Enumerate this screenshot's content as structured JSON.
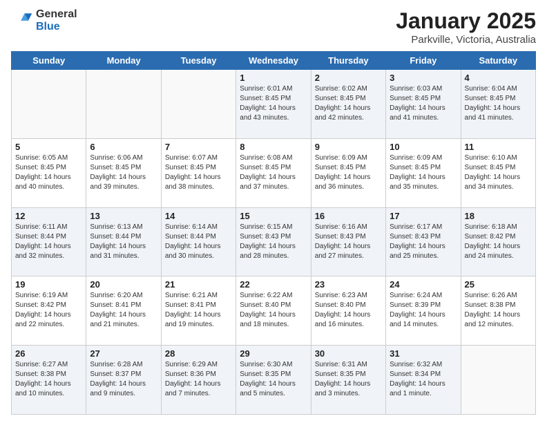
{
  "header": {
    "logo_general": "General",
    "logo_blue": "Blue",
    "title": "January 2025",
    "location": "Parkville, Victoria, Australia"
  },
  "weekdays": [
    "Sunday",
    "Monday",
    "Tuesday",
    "Wednesday",
    "Thursday",
    "Friday",
    "Saturday"
  ],
  "weeks": [
    [
      {
        "day": "",
        "info": ""
      },
      {
        "day": "",
        "info": ""
      },
      {
        "day": "",
        "info": ""
      },
      {
        "day": "1",
        "info": "Sunrise: 6:01 AM\nSunset: 8:45 PM\nDaylight: 14 hours\nand 43 minutes."
      },
      {
        "day": "2",
        "info": "Sunrise: 6:02 AM\nSunset: 8:45 PM\nDaylight: 14 hours\nand 42 minutes."
      },
      {
        "day": "3",
        "info": "Sunrise: 6:03 AM\nSunset: 8:45 PM\nDaylight: 14 hours\nand 41 minutes."
      },
      {
        "day": "4",
        "info": "Sunrise: 6:04 AM\nSunset: 8:45 PM\nDaylight: 14 hours\nand 41 minutes."
      }
    ],
    [
      {
        "day": "5",
        "info": "Sunrise: 6:05 AM\nSunset: 8:45 PM\nDaylight: 14 hours\nand 40 minutes."
      },
      {
        "day": "6",
        "info": "Sunrise: 6:06 AM\nSunset: 8:45 PM\nDaylight: 14 hours\nand 39 minutes."
      },
      {
        "day": "7",
        "info": "Sunrise: 6:07 AM\nSunset: 8:45 PM\nDaylight: 14 hours\nand 38 minutes."
      },
      {
        "day": "8",
        "info": "Sunrise: 6:08 AM\nSunset: 8:45 PM\nDaylight: 14 hours\nand 37 minutes."
      },
      {
        "day": "9",
        "info": "Sunrise: 6:09 AM\nSunset: 8:45 PM\nDaylight: 14 hours\nand 36 minutes."
      },
      {
        "day": "10",
        "info": "Sunrise: 6:09 AM\nSunset: 8:45 PM\nDaylight: 14 hours\nand 35 minutes."
      },
      {
        "day": "11",
        "info": "Sunrise: 6:10 AM\nSunset: 8:45 PM\nDaylight: 14 hours\nand 34 minutes."
      }
    ],
    [
      {
        "day": "12",
        "info": "Sunrise: 6:11 AM\nSunset: 8:44 PM\nDaylight: 14 hours\nand 32 minutes."
      },
      {
        "day": "13",
        "info": "Sunrise: 6:13 AM\nSunset: 8:44 PM\nDaylight: 14 hours\nand 31 minutes."
      },
      {
        "day": "14",
        "info": "Sunrise: 6:14 AM\nSunset: 8:44 PM\nDaylight: 14 hours\nand 30 minutes."
      },
      {
        "day": "15",
        "info": "Sunrise: 6:15 AM\nSunset: 8:43 PM\nDaylight: 14 hours\nand 28 minutes."
      },
      {
        "day": "16",
        "info": "Sunrise: 6:16 AM\nSunset: 8:43 PM\nDaylight: 14 hours\nand 27 minutes."
      },
      {
        "day": "17",
        "info": "Sunrise: 6:17 AM\nSunset: 8:43 PM\nDaylight: 14 hours\nand 25 minutes."
      },
      {
        "day": "18",
        "info": "Sunrise: 6:18 AM\nSunset: 8:42 PM\nDaylight: 14 hours\nand 24 minutes."
      }
    ],
    [
      {
        "day": "19",
        "info": "Sunrise: 6:19 AM\nSunset: 8:42 PM\nDaylight: 14 hours\nand 22 minutes."
      },
      {
        "day": "20",
        "info": "Sunrise: 6:20 AM\nSunset: 8:41 PM\nDaylight: 14 hours\nand 21 minutes."
      },
      {
        "day": "21",
        "info": "Sunrise: 6:21 AM\nSunset: 8:41 PM\nDaylight: 14 hours\nand 19 minutes."
      },
      {
        "day": "22",
        "info": "Sunrise: 6:22 AM\nSunset: 8:40 PM\nDaylight: 14 hours\nand 18 minutes."
      },
      {
        "day": "23",
        "info": "Sunrise: 6:23 AM\nSunset: 8:40 PM\nDaylight: 14 hours\nand 16 minutes."
      },
      {
        "day": "24",
        "info": "Sunrise: 6:24 AM\nSunset: 8:39 PM\nDaylight: 14 hours\nand 14 minutes."
      },
      {
        "day": "25",
        "info": "Sunrise: 6:26 AM\nSunset: 8:38 PM\nDaylight: 14 hours\nand 12 minutes."
      }
    ],
    [
      {
        "day": "26",
        "info": "Sunrise: 6:27 AM\nSunset: 8:38 PM\nDaylight: 14 hours\nand 10 minutes."
      },
      {
        "day": "27",
        "info": "Sunrise: 6:28 AM\nSunset: 8:37 PM\nDaylight: 14 hours\nand 9 minutes."
      },
      {
        "day": "28",
        "info": "Sunrise: 6:29 AM\nSunset: 8:36 PM\nDaylight: 14 hours\nand 7 minutes."
      },
      {
        "day": "29",
        "info": "Sunrise: 6:30 AM\nSunset: 8:35 PM\nDaylight: 14 hours\nand 5 minutes."
      },
      {
        "day": "30",
        "info": "Sunrise: 6:31 AM\nSunset: 8:35 PM\nDaylight: 14 hours\nand 3 minutes."
      },
      {
        "day": "31",
        "info": "Sunrise: 6:32 AM\nSunset: 8:34 PM\nDaylight: 14 hours\nand 1 minute."
      },
      {
        "day": "",
        "info": ""
      }
    ]
  ]
}
